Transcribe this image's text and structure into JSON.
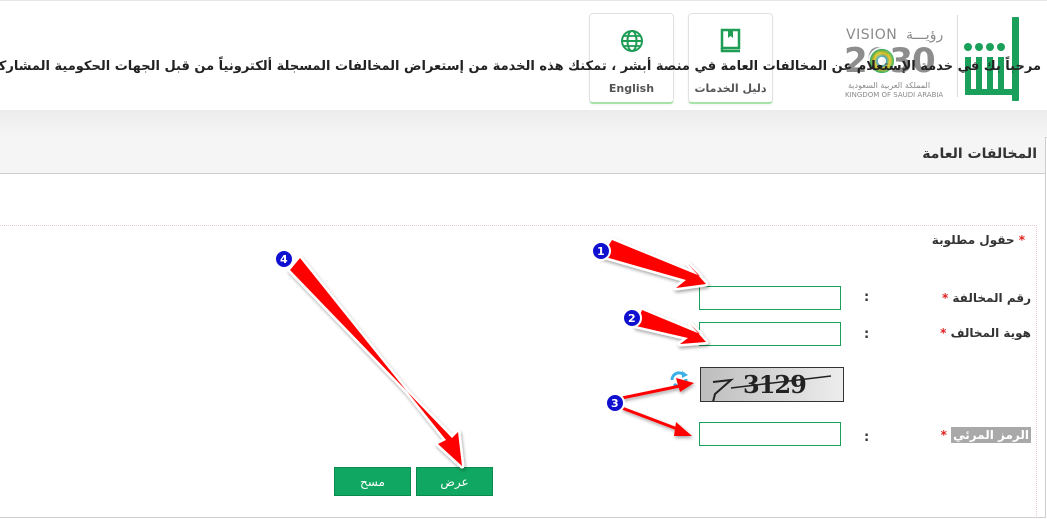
{
  "header": {
    "logo": {
      "brand_name": "أبشر",
      "vision_line1": "VISION",
      "vision_line1_ar": "رؤيـــة",
      "vision_year": "2030",
      "kingdom_ar": "المملكة العربية السعودية",
      "kingdom_en": "KINGDOM OF SAUDI ARABIA"
    },
    "buttons": [
      {
        "label": "دليل الخدمات",
        "icon": "book-icon"
      },
      {
        "label": "English",
        "icon": "globe-icon"
      }
    ],
    "accent_color": "#1aa05a"
  },
  "panel": {
    "title": "المخالفات العامة",
    "intro": "مرحباً بك في خدمة الإستعلام عن المخالفات العامة في منصة أبشر ، تمكنك هذه الخدمة من إستعراض المخالفات المسجلة ألكترونياً من قبل الجهات الحكومية المشاركة في الخدمة",
    "required_note": "حقول مطلوبة",
    "required_marker": "*"
  },
  "form": {
    "fields": [
      {
        "label": "رقم المخالفة",
        "colon": ":",
        "value": "",
        "placeholder": ""
      },
      {
        "label": "هوية المخالف",
        "colon": ":",
        "value": "",
        "placeholder": ""
      },
      {
        "label": "الرمز المرئي",
        "colon": ":",
        "value": "",
        "placeholder": ""
      }
    ],
    "captcha_text": "3129",
    "buttons": {
      "show": "عرض",
      "clear": "مسح"
    }
  },
  "annotations": [
    {
      "number": "1",
      "target": "violation-number-field"
    },
    {
      "number": "2",
      "target": "violator-id-field"
    },
    {
      "number": "3",
      "target": "captcha"
    },
    {
      "number": "4",
      "target": "show-button"
    }
  ],
  "colors": {
    "button_green": "#0fa761",
    "arrow_red": "#ff0000",
    "badge_blue": "#1010d0",
    "required_red": "#e02020"
  }
}
